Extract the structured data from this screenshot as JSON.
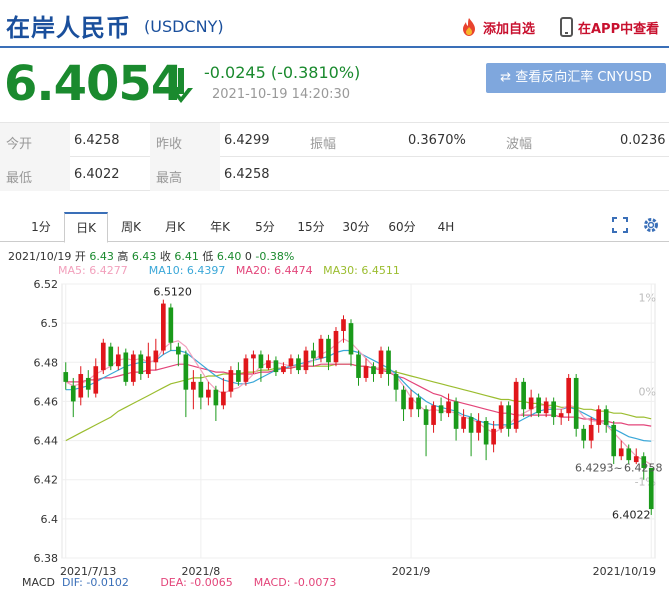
{
  "header": {
    "title": "在岸人民币",
    "code": "(USDCNY)",
    "add_watch": "添加自选",
    "app_view": "在APP中查看"
  },
  "quote": {
    "price": "6.4054",
    "change": "-0.0245 (-0.3810%)",
    "time": "2021-10-19 14:20:30",
    "reverse_button": "查看反向汇率 CNYUSD"
  },
  "info": {
    "open_label": "今开",
    "open": "6.4258",
    "prev_close_label": "昨收",
    "prev_close": "6.4299",
    "amplitude_label": "振幅",
    "amplitude": "0.3670%",
    "wave_label": "波幅",
    "wave": "0.0236",
    "low_label": "最低",
    "low": "6.4022",
    "high_label": "最高",
    "high": "6.4258"
  },
  "tabs": [
    "1分",
    "日K",
    "周K",
    "月K",
    "年K",
    "5分",
    "15分",
    "30分",
    "60分",
    "4H"
  ],
  "active_tab": "日K",
  "legend": {
    "date": "2021/10/19",
    "open_label": "开",
    "open": "6.43",
    "high_label": "高",
    "high": "6.43",
    "close_label": "收",
    "close": "6.41",
    "low_label": "低",
    "low": "6.40",
    "vol": "0",
    "pct": "-0.38%",
    "ma5": "MA5: 6.4277",
    "ma10": "MA10: 6.4397",
    "ma20": "MA20: 6.4474",
    "ma30": "MA30: 6.4511"
  },
  "macd": {
    "label": "MACD",
    "dif": "DIF: -0.0102",
    "dea": "DEA: -0.0065",
    "macd": "MACD: -0.0073"
  },
  "colors": {
    "up": "#e0161b",
    "down": "#1a9a1a",
    "ma5": "#f2a0bc",
    "ma10": "#3aa7d8",
    "ma20": "#e3457a",
    "ma30": "#9bbd2f"
  },
  "chart_data": {
    "type": "candlestick",
    "y_ticks": [
      "6.52",
      "6.5",
      "6.48",
      "6.46",
      "6.44",
      "6.42",
      "6.4",
      "6.38"
    ],
    "ylim": [
      6.38,
      6.52
    ],
    "pct_ticks": [
      "1%",
      "0%",
      "-1%"
    ],
    "x_ticks": [
      "2021/7/13",
      "2021/8",
      "2021/9",
      "2021/10/19"
    ],
    "annotations": [
      "6.5120",
      "6.4293",
      "6.4258",
      "6.4022"
    ],
    "candles": [
      [
        6.475,
        6.47,
        6.48,
        6.466
      ],
      [
        6.468,
        6.46,
        6.472,
        6.452
      ],
      [
        6.462,
        6.474,
        6.478,
        6.458
      ],
      [
        6.472,
        6.466,
        6.476,
        6.462
      ],
      [
        6.464,
        6.478,
        6.482,
        6.462
      ],
      [
        6.476,
        6.49,
        6.492,
        6.474
      ],
      [
        6.488,
        6.478,
        6.49,
        6.476
      ],
      [
        6.478,
        6.484,
        6.488,
        6.476
      ],
      [
        6.485,
        6.47,
        6.487,
        6.468
      ],
      [
        6.47,
        6.484,
        6.486,
        6.468
      ],
      [
        6.484,
        6.474,
        6.486,
        6.471
      ],
      [
        6.474,
        6.483,
        6.49,
        6.472
      ],
      [
        6.48,
        6.486,
        6.492,
        6.476
      ],
      [
        6.486,
        6.51,
        6.512,
        6.484
      ],
      [
        6.508,
        6.49,
        6.51,
        6.486
      ],
      [
        6.488,
        6.484,
        6.49,
        6.478
      ],
      [
        6.484,
        6.466,
        6.486,
        6.452
      ],
      [
        6.466,
        6.47,
        6.476,
        6.456
      ],
      [
        6.47,
        6.462,
        6.474,
        6.456
      ],
      [
        6.462,
        6.466,
        6.47,
        6.458
      ],
      [
        6.466,
        6.458,
        6.468,
        6.45
      ],
      [
        6.458,
        6.465,
        6.472,
        6.456
      ],
      [
        6.465,
        6.476,
        6.478,
        6.462
      ],
      [
        6.476,
        6.47,
        6.48,
        6.468
      ],
      [
        6.47,
        6.482,
        6.484,
        6.468
      ],
      [
        6.482,
        6.484,
        6.486,
        6.474
      ],
      [
        6.484,
        6.477,
        6.486,
        6.47
      ],
      [
        6.477,
        6.481,
        6.484,
        6.476
      ],
      [
        6.481,
        6.475,
        6.483,
        6.473
      ],
      [
        6.475,
        6.478,
        6.48,
        6.474
      ],
      [
        6.478,
        6.482,
        6.484,
        6.474
      ],
      [
        6.482,
        6.476,
        6.484,
        6.474
      ],
      [
        6.476,
        6.486,
        6.488,
        6.474
      ],
      [
        6.486,
        6.482,
        6.49,
        6.478
      ],
      [
        6.482,
        6.492,
        6.494,
        6.48
      ],
      [
        6.492,
        6.48,
        6.494,
        6.476
      ],
      [
        6.48,
        6.496,
        6.498,
        6.478
      ],
      [
        6.496,
        6.502,
        6.504,
        6.49
      ],
      [
        6.5,
        6.484,
        6.502,
        6.478
      ],
      [
        6.484,
        6.472,
        6.486,
        6.468
      ],
      [
        6.472,
        6.478,
        6.482,
        6.47
      ],
      [
        6.478,
        6.474,
        6.48,
        6.47
      ],
      [
        6.474,
        6.486,
        6.488,
        6.472
      ],
      [
        6.486,
        6.474,
        6.488,
        6.468
      ],
      [
        6.474,
        6.466,
        6.476,
        6.46
      ],
      [
        6.466,
        6.456,
        6.468,
        6.45
      ],
      [
        6.456,
        6.462,
        6.466,
        6.452
      ],
      [
        6.462,
        6.456,
        6.464,
        6.452
      ],
      [
        6.456,
        6.448,
        6.458,
        6.432
      ],
      [
        6.448,
        6.458,
        6.46,
        6.444
      ],
      [
        6.458,
        6.454,
        6.462,
        6.45
      ],
      [
        6.454,
        6.46,
        6.464,
        6.452
      ],
      [
        6.46,
        6.446,
        6.462,
        6.44
      ],
      [
        6.446,
        6.452,
        6.456,
        6.444
      ],
      [
        6.452,
        6.444,
        6.454,
        6.432
      ],
      [
        6.444,
        6.45,
        6.454,
        6.44
      ],
      [
        6.45,
        6.438,
        6.452,
        6.43
      ],
      [
        6.438,
        6.446,
        6.45,
        6.434
      ],
      [
        6.446,
        6.458,
        6.46,
        6.444
      ],
      [
        6.458,
        6.446,
        6.46,
        6.442
      ],
      [
        6.446,
        6.47,
        6.472,
        6.444
      ],
      [
        6.47,
        6.456,
        6.472,
        6.452
      ],
      [
        6.456,
        6.462,
        6.466,
        6.452
      ],
      [
        6.462,
        6.454,
        6.464,
        6.452
      ],
      [
        6.454,
        6.46,
        6.462,
        6.452
      ],
      [
        6.46,
        6.452,
        6.462,
        6.448
      ],
      [
        6.452,
        6.454,
        6.456,
        6.448
      ],
      [
        6.454,
        6.472,
        6.474,
        6.45
      ],
      [
        6.472,
        6.446,
        6.474,
        6.442
      ],
      [
        6.446,
        6.44,
        6.448,
        6.436
      ],
      [
        6.44,
        6.448,
        6.452,
        6.436
      ],
      [
        6.448,
        6.456,
        6.458,
        6.444
      ],
      [
        6.456,
        6.448,
        6.458,
        6.444
      ],
      [
        6.448,
        6.432,
        6.45,
        6.428
      ],
      [
        6.432,
        6.436,
        6.44,
        6.43
      ],
      [
        6.436,
        6.43,
        6.438,
        6.428
      ],
      [
        6.429,
        6.432,
        6.436,
        6.428
      ],
      [
        6.432,
        6.426,
        6.434,
        6.42
      ],
      [
        6.426,
        6.405,
        6.426,
        6.402
      ]
    ],
    "ma5": [
      6.47,
      6.468,
      6.469,
      6.471,
      6.474,
      6.476,
      6.478,
      6.481,
      6.482,
      6.481,
      6.482,
      6.48,
      6.481,
      6.487,
      6.49,
      6.491,
      6.488,
      6.482,
      6.476,
      6.47,
      6.466,
      6.464,
      6.466,
      6.467,
      6.47,
      6.474,
      6.478,
      6.48,
      6.48,
      6.479,
      6.478,
      6.478,
      6.479,
      6.481,
      6.484,
      6.486,
      6.489,
      6.492,
      6.49,
      6.486,
      6.482,
      6.478,
      6.476,
      6.476,
      6.473,
      6.468,
      6.462,
      6.458,
      6.455,
      6.456,
      6.455,
      6.455,
      6.454,
      6.452,
      6.451,
      6.449,
      6.446,
      6.444,
      6.446,
      6.448,
      6.452,
      6.454,
      6.456,
      6.458,
      6.458,
      6.456,
      6.456,
      6.458,
      6.457,
      6.452,
      6.45,
      6.45,
      6.448,
      6.444,
      6.44,
      6.436,
      6.432,
      6.43,
      6.4277
    ],
    "ma10": [
      6.466,
      6.466,
      6.467,
      6.468,
      6.47,
      6.472,
      6.474,
      6.476,
      6.478,
      6.479,
      6.48,
      6.48,
      6.481,
      6.484,
      6.486,
      6.486,
      6.485,
      6.482,
      6.479,
      6.476,
      6.473,
      6.471,
      6.47,
      6.469,
      6.469,
      6.47,
      6.472,
      6.474,
      6.476,
      6.477,
      6.478,
      6.479,
      6.48,
      6.481,
      6.482,
      6.483,
      6.485,
      6.486,
      6.486,
      6.485,
      6.483,
      6.481,
      6.479,
      6.477,
      6.474,
      6.47,
      6.466,
      6.463,
      6.46,
      6.458,
      6.457,
      6.456,
      6.455,
      6.453,
      6.452,
      6.45,
      6.449,
      6.448,
      6.448,
      6.448,
      6.449,
      6.451,
      6.453,
      6.455,
      6.456,
      6.456,
      6.456,
      6.457,
      6.456,
      6.454,
      6.452,
      6.45,
      6.448,
      6.446,
      6.444,
      6.442,
      6.441,
      6.44,
      6.4397
    ],
    "ma20": [
      6.47,
      6.47,
      6.47,
      6.471,
      6.471,
      6.472,
      6.472,
      6.473,
      6.474,
      6.475,
      6.475,
      6.476,
      6.476,
      6.477,
      6.478,
      6.479,
      6.479,
      6.478,
      6.477,
      6.476,
      6.475,
      6.475,
      6.474,
      6.474,
      6.474,
      6.474,
      6.475,
      6.475,
      6.476,
      6.477,
      6.477,
      6.478,
      6.478,
      6.478,
      6.479,
      6.479,
      6.479,
      6.479,
      6.479,
      6.478,
      6.478,
      6.477,
      6.476,
      6.475,
      6.473,
      6.472,
      6.47,
      6.468,
      6.466,
      6.464,
      6.463,
      6.461,
      6.46,
      6.459,
      6.458,
      6.457,
      6.456,
      6.455,
      6.454,
      6.454,
      6.453,
      6.453,
      6.453,
      6.453,
      6.453,
      6.453,
      6.452,
      6.452,
      6.452,
      6.451,
      6.451,
      6.45,
      6.45,
      6.449,
      6.449,
      6.448,
      6.448,
      6.448,
      6.4474
    ],
    "ma30": [
      6.44,
      6.442,
      6.444,
      6.446,
      6.448,
      6.45,
      6.452,
      6.455,
      6.457,
      6.459,
      6.461,
      6.463,
      6.465,
      6.467,
      6.469,
      6.47,
      6.471,
      6.472,
      6.472,
      6.473,
      6.473,
      6.474,
      6.474,
      6.474,
      6.475,
      6.475,
      6.476,
      6.476,
      6.477,
      6.477,
      6.477,
      6.478,
      6.478,
      6.478,
      6.478,
      6.478,
      6.479,
      6.479,
      6.479,
      6.478,
      6.478,
      6.477,
      6.477,
      6.476,
      6.475,
      6.474,
      6.473,
      6.472,
      6.471,
      6.47,
      6.469,
      6.468,
      6.467,
      6.466,
      6.465,
      6.464,
      6.463,
      6.462,
      6.461,
      6.461,
      6.46,
      6.46,
      6.459,
      6.459,
      6.458,
      6.458,
      6.457,
      6.457,
      6.457,
      6.456,
      6.456,
      6.455,
      6.455,
      6.454,
      6.454,
      6.453,
      6.452,
      6.452,
      6.4511
    ]
  }
}
